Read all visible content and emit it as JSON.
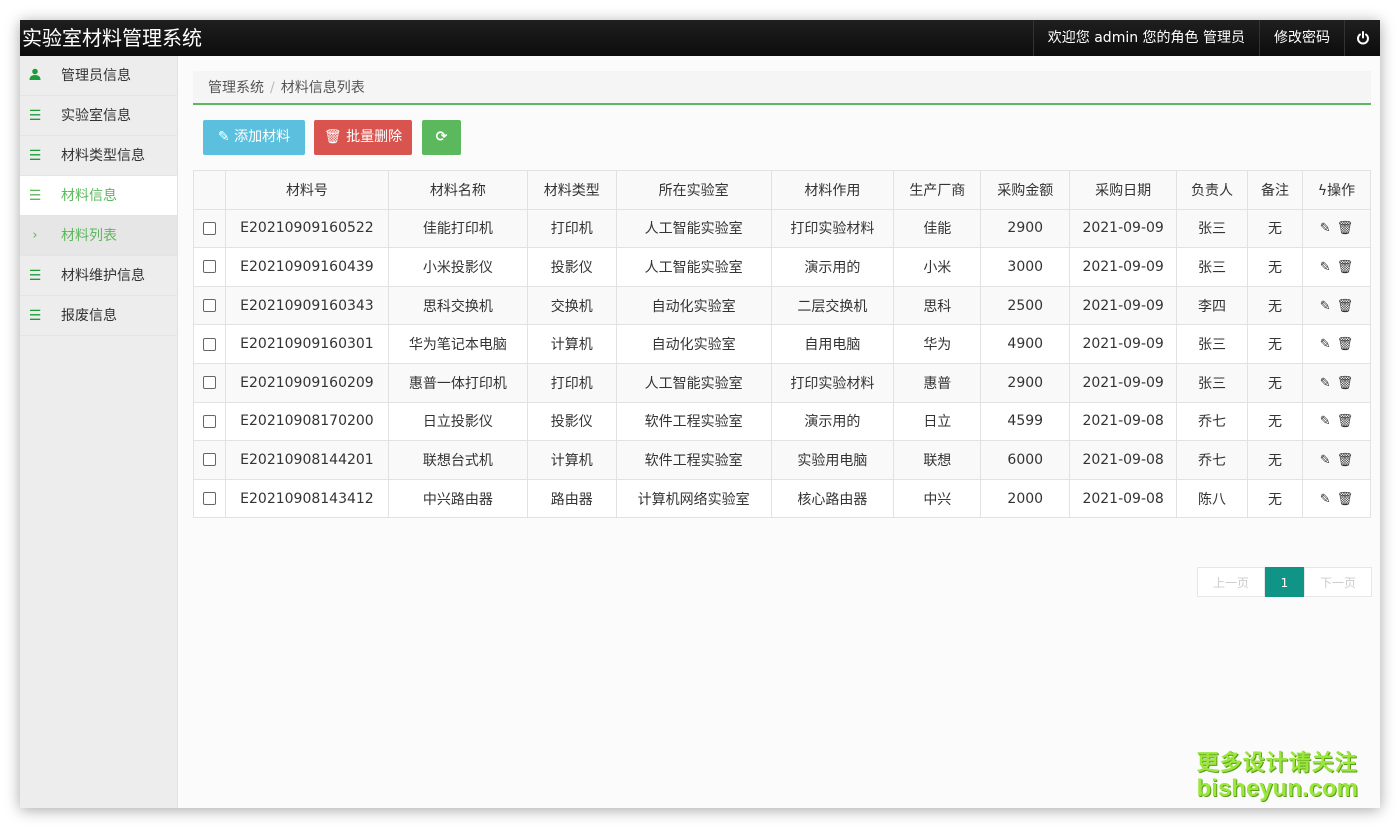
{
  "app": {
    "title": "实验室材料管理系统",
    "welcome": "欢迎您 admin 您的角色 管理员",
    "change_password": "修改密码",
    "power_icon": "power-icon"
  },
  "sidebar": {
    "items": [
      {
        "label": "管理员信息",
        "icon": "user-icon"
      },
      {
        "label": "实验室信息",
        "icon": "list-icon"
      },
      {
        "label": "材料类型信息",
        "icon": "list-icon"
      },
      {
        "label": "材料信息",
        "icon": "list-icon"
      },
      {
        "label": "材料列表",
        "icon": "chevron-right-icon"
      },
      {
        "label": "材料维护信息",
        "icon": "list-icon"
      },
      {
        "label": "报废信息",
        "icon": "list-icon"
      }
    ]
  },
  "breadcrumb": {
    "root": "管理系统",
    "separator": "/",
    "current": "材料信息列表"
  },
  "toolbar": {
    "add_label": "添加材料",
    "batch_delete_label": "批量删除"
  },
  "table": {
    "headers": [
      "材料号",
      "材料名称",
      "材料类型",
      "所在实验室",
      "材料作用",
      "生产厂商",
      "采购金额",
      "采购日期",
      "负责人",
      "备注",
      "操作"
    ],
    "rows": [
      [
        "E20210909160522",
        "佳能打印机",
        "打印机",
        "人工智能实验室",
        "打印实验材料",
        "佳能",
        "2900",
        "2021-09-09",
        "张三",
        "无"
      ],
      [
        "E20210909160439",
        "小米投影仪",
        "投影仪",
        "人工智能实验室",
        "演示用的",
        "小米",
        "3000",
        "2021-09-09",
        "张三",
        "无"
      ],
      [
        "E20210909160343",
        "思科交换机",
        "交换机",
        "自动化实验室",
        "二层交换机",
        "思科",
        "2500",
        "2021-09-09",
        "李四",
        "无"
      ],
      [
        "E20210909160301",
        "华为笔记本电脑",
        "计算机",
        "自动化实验室",
        "自用电脑",
        "华为",
        "4900",
        "2021-09-09",
        "张三",
        "无"
      ],
      [
        "E20210909160209",
        "惠普一体打印机",
        "打印机",
        "人工智能实验室",
        "打印实验材料",
        "惠普",
        "2900",
        "2021-09-09",
        "张三",
        "无"
      ],
      [
        "E20210908170200",
        "日立投影仪",
        "投影仪",
        "软件工程实验室",
        "演示用的",
        "日立",
        "4599",
        "2021-09-08",
        "乔七",
        "无"
      ],
      [
        "E20210908144201",
        "联想台式机",
        "计算机",
        "软件工程实验室",
        "实验用电脑",
        "联想",
        "6000",
        "2021-09-08",
        "乔七",
        "无"
      ],
      [
        "E20210908143412",
        "中兴路由器",
        "路由器",
        "计算机网络实验室",
        "核心路由器",
        "中兴",
        "2000",
        "2021-09-08",
        "陈八",
        "无"
      ]
    ]
  },
  "pagination": {
    "prev": "上一页",
    "current": "1",
    "next": "下一页"
  },
  "watermark": {
    "line1": "更多设计请关注",
    "line2": "bisheyun.com"
  },
  "colors": {
    "accent_green": "#5cb85c",
    "add_button": "#5bc0de",
    "delete_button": "#d9534f",
    "page_active": "#109485"
  }
}
